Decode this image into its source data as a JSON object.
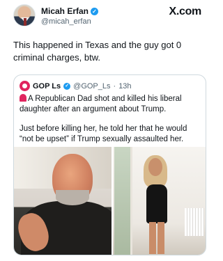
{
  "author": {
    "name": "Micah Erfan",
    "handle": "@micah_erfan",
    "verified_icon": "verified-badge-icon"
  },
  "platform": {
    "logo_text": "X.com"
  },
  "tweet": {
    "text": "This happened in Texas and the guy got 0 criminal charges, btw."
  },
  "quote": {
    "name": "GOP Ls",
    "handle": "@GOP_Ls",
    "separator": "·",
    "time": "13h",
    "avatar_icon": "gop-ls-avatar-icon",
    "lead_icon": "siren-icon",
    "paragraph_1": "A Republican Dad shot and killed his liberal daughter after an argument about Trump.",
    "paragraph_2": "Just before killing her, he told her that he would “not be upset” if Trump sexually assaulted her."
  },
  "colors": {
    "verified": "#1d9bf0",
    "text": "#0f1419",
    "secondary_text": "#536471",
    "border": "#cfd9de",
    "quote_avatar": "#e0245e"
  }
}
